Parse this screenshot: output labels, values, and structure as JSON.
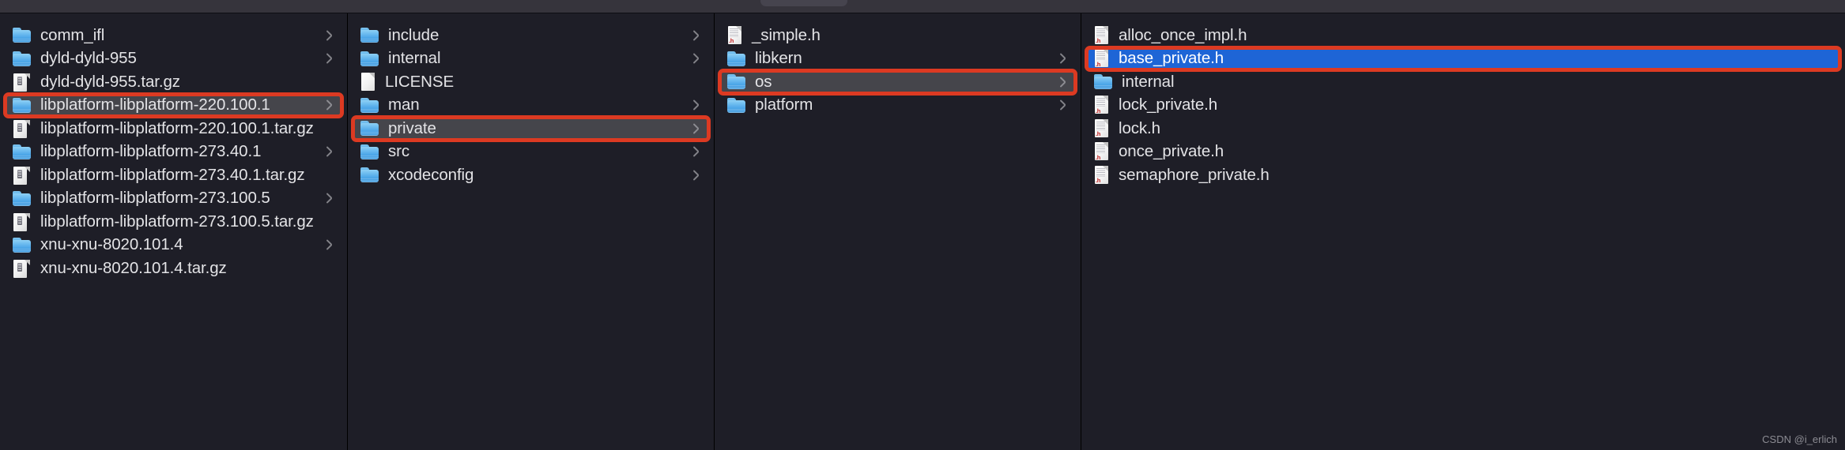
{
  "window": {
    "title": "",
    "view_mode": "column",
    "theme": "dark"
  },
  "colors": {
    "background": "#1e1e27",
    "toolbar": "#36343c",
    "row_selected_inactive": "#45454b",
    "row_selected_active": "#1e65d6",
    "annotation_red": "#dc3a22",
    "text": "#e3e3e6",
    "chevron": "#a9a9ae",
    "folder_blue": "#4ca6e8",
    "header_ext_red": "#c02020"
  },
  "columns": [
    {
      "name": "column-1",
      "items": [
        {
          "label": "comm_ifl",
          "icon": "folder-icon",
          "chevron": true,
          "selected": false,
          "highlighted": false
        },
        {
          "label": "dyld-dyld-955",
          "icon": "folder-icon",
          "chevron": true,
          "selected": false,
          "highlighted": false
        },
        {
          "label": "dyld-dyld-955.tar.gz",
          "icon": "archive-icon",
          "chevron": false,
          "selected": false,
          "highlighted": false
        },
        {
          "label": "libplatform-libplatform-220.100.1",
          "icon": "folder-icon",
          "chevron": true,
          "selected": true,
          "highlighted": true
        },
        {
          "label": "libplatform-libplatform-220.100.1.tar.gz",
          "icon": "archive-icon",
          "chevron": false,
          "selected": false,
          "highlighted": false
        },
        {
          "label": "libplatform-libplatform-273.40.1",
          "icon": "folder-icon",
          "chevron": true,
          "selected": false,
          "highlighted": false
        },
        {
          "label": "libplatform-libplatform-273.40.1.tar.gz",
          "icon": "archive-icon",
          "chevron": false,
          "selected": false,
          "highlighted": false
        },
        {
          "label": "libplatform-libplatform-273.100.5",
          "icon": "folder-icon",
          "chevron": true,
          "selected": false,
          "highlighted": false
        },
        {
          "label": "libplatform-libplatform-273.100.5.tar.gz",
          "icon": "archive-icon",
          "chevron": false,
          "selected": false,
          "highlighted": false
        },
        {
          "label": "xnu-xnu-8020.101.4",
          "icon": "folder-icon",
          "chevron": true,
          "selected": false,
          "highlighted": false
        },
        {
          "label": "xnu-xnu-8020.101.4.tar.gz",
          "icon": "archive-icon",
          "chevron": false,
          "selected": false,
          "highlighted": false
        }
      ]
    },
    {
      "name": "column-2",
      "items": [
        {
          "label": "include",
          "icon": "folder-icon",
          "chevron": true,
          "selected": false,
          "highlighted": false
        },
        {
          "label": "internal",
          "icon": "folder-icon",
          "chevron": true,
          "selected": false,
          "highlighted": false
        },
        {
          "label": "LICENSE",
          "icon": "document-icon",
          "chevron": false,
          "selected": false,
          "highlighted": false
        },
        {
          "label": "man",
          "icon": "folder-icon",
          "chevron": true,
          "selected": false,
          "highlighted": false
        },
        {
          "label": "private",
          "icon": "folder-icon",
          "chevron": true,
          "selected": true,
          "highlighted": true
        },
        {
          "label": "src",
          "icon": "folder-icon",
          "chevron": true,
          "selected": false,
          "highlighted": false
        },
        {
          "label": "xcodeconfig",
          "icon": "folder-icon",
          "chevron": true,
          "selected": false,
          "highlighted": false
        }
      ]
    },
    {
      "name": "column-3",
      "items": [
        {
          "label": "_simple.h",
          "icon": "header-file-icon",
          "chevron": false,
          "selected": false,
          "highlighted": false
        },
        {
          "label": "libkern",
          "icon": "folder-icon",
          "chevron": true,
          "selected": false,
          "highlighted": false
        },
        {
          "label": "os",
          "icon": "folder-icon",
          "chevron": true,
          "selected": true,
          "highlighted": true
        },
        {
          "label": "platform",
          "icon": "folder-icon",
          "chevron": true,
          "selected": false,
          "highlighted": false
        }
      ]
    },
    {
      "name": "column-4",
      "items": [
        {
          "label": "alloc_once_impl.h",
          "icon": "header-file-icon",
          "chevron": false,
          "selected": false,
          "highlighted": false
        },
        {
          "label": "base_private.h",
          "icon": "header-file-icon",
          "chevron": false,
          "selected": "blue",
          "highlighted": true
        },
        {
          "label": "internal",
          "icon": "folder-icon",
          "chevron": false,
          "selected": false,
          "highlighted": false
        },
        {
          "label": "lock_private.h",
          "icon": "header-file-icon",
          "chevron": false,
          "selected": false,
          "highlighted": false
        },
        {
          "label": "lock.h",
          "icon": "header-file-icon",
          "chevron": false,
          "selected": false,
          "highlighted": false
        },
        {
          "label": "once_private.h",
          "icon": "header-file-icon",
          "chevron": false,
          "selected": false,
          "highlighted": false
        },
        {
          "label": "semaphore_private.h",
          "icon": "header-file-icon",
          "chevron": false,
          "selected": false,
          "highlighted": false
        }
      ]
    }
  ],
  "annotations": {
    "boxes": [
      {
        "name": "highlight-libplatform-220",
        "target": "libplatform-libplatform-220.100.1"
      },
      {
        "name": "highlight-private",
        "target": "private"
      },
      {
        "name": "highlight-os",
        "target": "os"
      },
      {
        "name": "highlight-base-private-h",
        "target": "base_private.h"
      }
    ]
  },
  "watermark": {
    "text": "CSDN @i_erlich"
  }
}
